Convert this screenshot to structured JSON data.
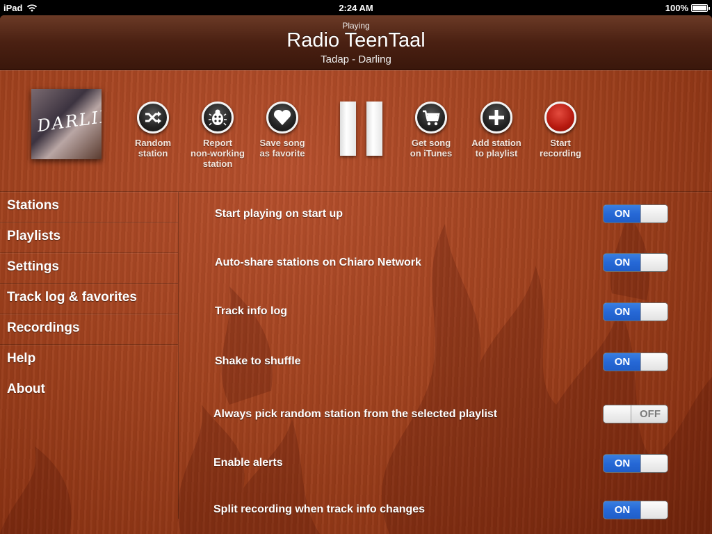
{
  "status_bar": {
    "device": "iPad",
    "time": "2:24 AM",
    "battery": "100%"
  },
  "header": {
    "subtitle": "Playing",
    "station": "Radio TeenTaal",
    "track": "Tadap - Darling"
  },
  "album": {
    "title_script": "DARLING"
  },
  "controls": [
    {
      "label": "Random station",
      "icon": "shuffle-icon"
    },
    {
      "label": "Report non-working station",
      "icon": "bug-icon"
    },
    {
      "label": "Save song as favorite",
      "icon": "heart-icon"
    },
    {
      "label": "Get song on iTunes",
      "icon": "cart-icon"
    },
    {
      "label": "Add station to playlist",
      "icon": "plus-icon"
    },
    {
      "label": "Start recording",
      "icon": "record-icon"
    }
  ],
  "control_lines": {
    "random": [
      "Random",
      "station"
    ],
    "report": [
      "Report",
      "non-working",
      "station"
    ],
    "favorite": [
      "Save song",
      "as favorite"
    ],
    "itunes": [
      "Get song",
      "on iTunes"
    ],
    "playlist": [
      "Add station",
      "to playlist"
    ],
    "record": [
      "Start",
      "recording"
    ]
  },
  "sidebar": {
    "items": [
      {
        "label": "Stations"
      },
      {
        "label": "Playlists"
      },
      {
        "label": "Settings"
      },
      {
        "label": "Track log & favorites"
      },
      {
        "label": "Recordings"
      },
      {
        "label": "Help"
      },
      {
        "label": "About"
      }
    ]
  },
  "settings": [
    {
      "label": "Start playing on start up",
      "state": "ON"
    },
    {
      "label": "Auto-share stations on Chiaro Network",
      "state": "ON"
    },
    {
      "label": "Track info log",
      "state": "ON"
    },
    {
      "label": "Shake to shuffle",
      "state": "ON"
    },
    {
      "label": "Always pick random station from the selected playlist",
      "state": "OFF"
    },
    {
      "label": "Enable alerts",
      "state": "ON"
    },
    {
      "label": "Split recording when track info changes",
      "state": "ON"
    }
  ],
  "colors": {
    "toggle_on": "#2668d6",
    "wood": "#a2431f",
    "record": "#b6190f"
  }
}
